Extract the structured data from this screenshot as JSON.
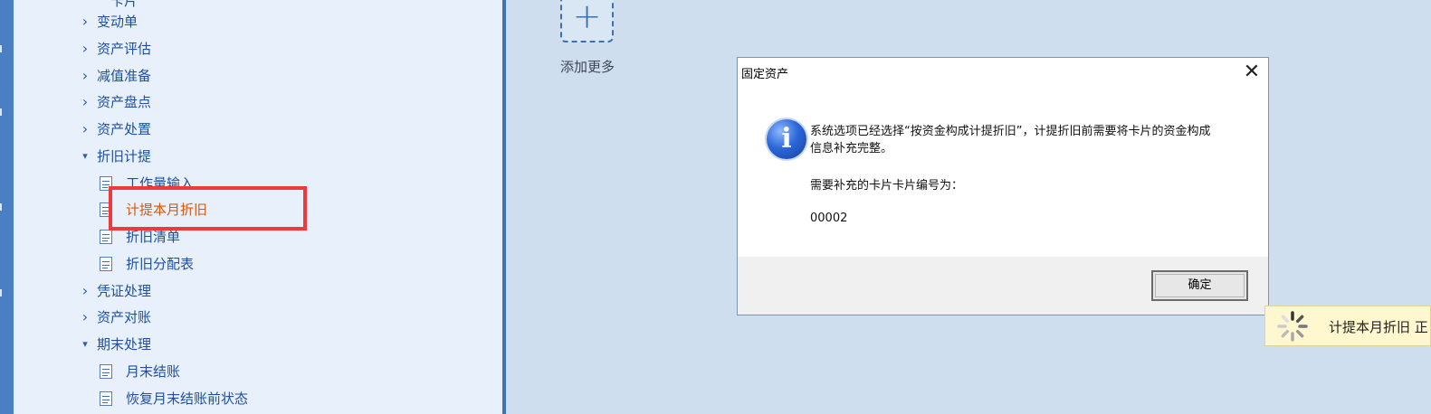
{
  "tree": {
    "items": [
      {
        "label": "变动单",
        "kind": "folder",
        "expanded": false
      },
      {
        "label": "资产评估",
        "kind": "folder",
        "expanded": false
      },
      {
        "label": "减值准备",
        "kind": "folder",
        "expanded": false
      },
      {
        "label": "资产盘点",
        "kind": "folder",
        "expanded": false
      },
      {
        "label": "资产处置",
        "kind": "folder",
        "expanded": false
      },
      {
        "label": "折旧计提",
        "kind": "folder",
        "expanded": true
      },
      {
        "label": "工作量输入",
        "kind": "leaf"
      },
      {
        "label": "计提本月折旧",
        "kind": "leaf",
        "active": true
      },
      {
        "label": "折旧清单",
        "kind": "leaf"
      },
      {
        "label": "折旧分配表",
        "kind": "leaf"
      },
      {
        "label": "凭证处理",
        "kind": "folder",
        "expanded": false
      },
      {
        "label": "资产对账",
        "kind": "folder",
        "expanded": false
      },
      {
        "label": "期末处理",
        "kind": "folder",
        "expanded": true
      },
      {
        "label": "月末结账",
        "kind": "leaf"
      },
      {
        "label": "恢复月末结账前状态",
        "kind": "leaf"
      }
    ]
  },
  "add_more": {
    "label": "添加更多"
  },
  "dialog": {
    "title": "固定资产",
    "message_line1": "系统选项已经选择“按资金构成计提折旧”，计提折旧前需要将卡片的资金构成",
    "message_line2": "信息补充完整。",
    "message_line3": "需要补充的卡片卡片编号为：",
    "card_number": "00002",
    "ok_label": "确定",
    "close_symbol": "✕"
  },
  "toast": {
    "label": "计提本月折旧 正"
  },
  "colors": {
    "accent": "#3f73b8",
    "highlight_border": "#ee3a3a",
    "active_text": "#d05a10"
  }
}
